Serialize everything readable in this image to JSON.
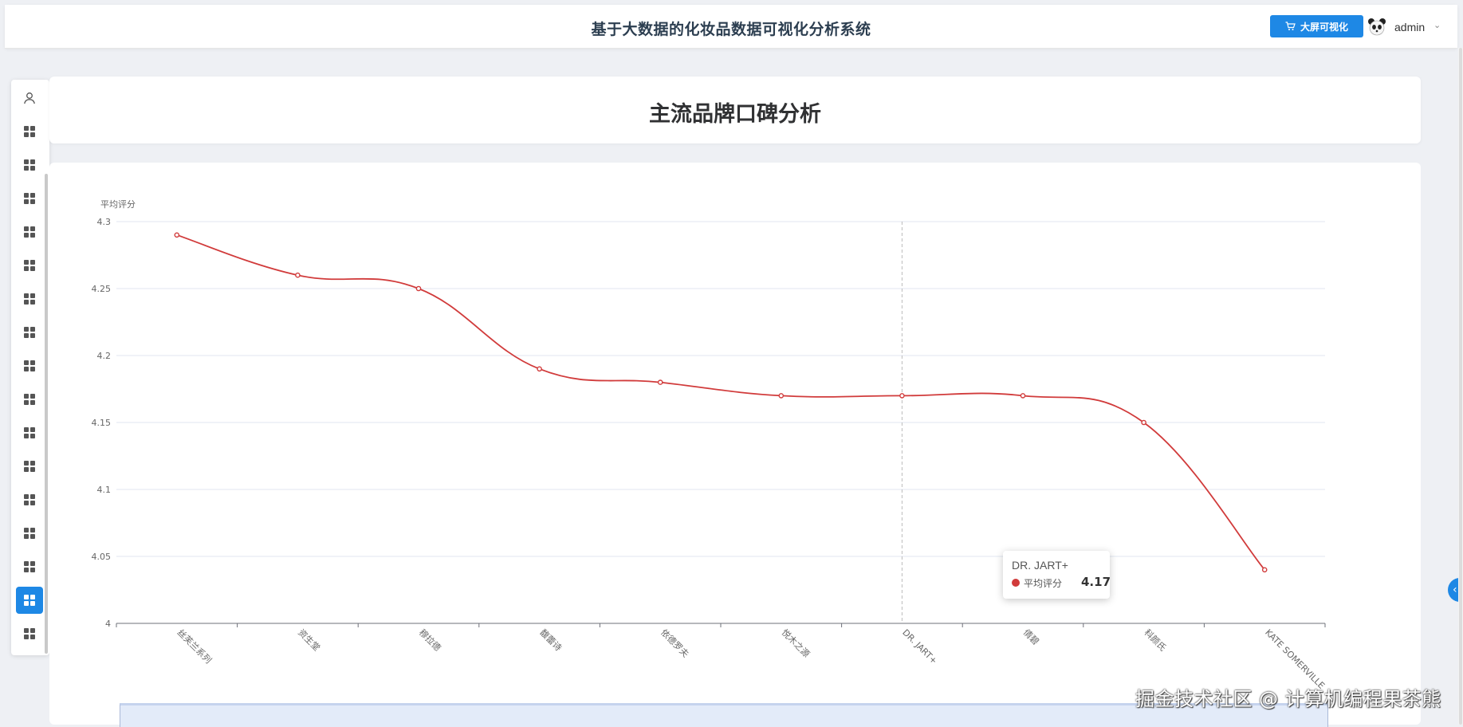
{
  "header": {
    "app_title": "基于大数据的化妆品数据可视化分析系统",
    "big_screen_button": "大屏可视化",
    "big_screen_icon": "cart-icon",
    "user_name": "admin"
  },
  "sidebar": {
    "items": [
      {
        "icon": "user-icon",
        "active": false
      },
      {
        "icon": "grid-icon",
        "active": false
      },
      {
        "icon": "grid-icon",
        "active": false
      },
      {
        "icon": "grid-icon",
        "active": false
      },
      {
        "icon": "grid-icon",
        "active": false
      },
      {
        "icon": "grid-icon",
        "active": false
      },
      {
        "icon": "grid-icon",
        "active": false
      },
      {
        "icon": "grid-icon",
        "active": false
      },
      {
        "icon": "grid-icon",
        "active": false
      },
      {
        "icon": "grid-icon",
        "active": false
      },
      {
        "icon": "grid-icon",
        "active": false
      },
      {
        "icon": "grid-icon",
        "active": false
      },
      {
        "icon": "grid-icon",
        "active": false
      },
      {
        "icon": "grid-icon",
        "active": false
      },
      {
        "icon": "grid-icon",
        "active": false
      },
      {
        "icon": "grid-icon",
        "active": true
      },
      {
        "icon": "grid-icon",
        "active": false
      }
    ]
  },
  "page": {
    "title": "主流品牌口碑分析"
  },
  "chart_data": {
    "type": "line",
    "smooth": true,
    "ylabel": "平均评分",
    "ylim": [
      4,
      4.3
    ],
    "yticks": [
      4,
      4.05,
      4.1,
      4.15,
      4.2,
      4.25,
      4.3
    ],
    "ytick_labels": [
      "4",
      "4.05",
      "4.1",
      "4.15",
      "4.2",
      "4.25",
      "4.3"
    ],
    "grid": true,
    "categories": [
      "丝芙兰系列",
      "资生堂",
      "穆拉德",
      "馥蕾诗",
      "依德罗夫",
      "悦木之源",
      "DR. JART+",
      "倩碧",
      "科颜氏",
      "KATE SOMERVILLE"
    ],
    "series": [
      {
        "name": "平均评分",
        "values": [
          4.29,
          4.26,
          4.25,
          4.19,
          4.18,
          4.17,
          4.17,
          4.17,
          4.15,
          4.04
        ],
        "color": "#d13b3b"
      }
    ],
    "hover_index": 6
  },
  "tooltip": {
    "category": "DR. JART+",
    "series_name": "平均评分",
    "value": "4.17",
    "dot_color": "#d13b3b"
  },
  "watermark": "掘金技术社区 @ 计算机编程果茶熊",
  "colors": {
    "accent": "#1e88e5",
    "line": "#d13b3b"
  }
}
